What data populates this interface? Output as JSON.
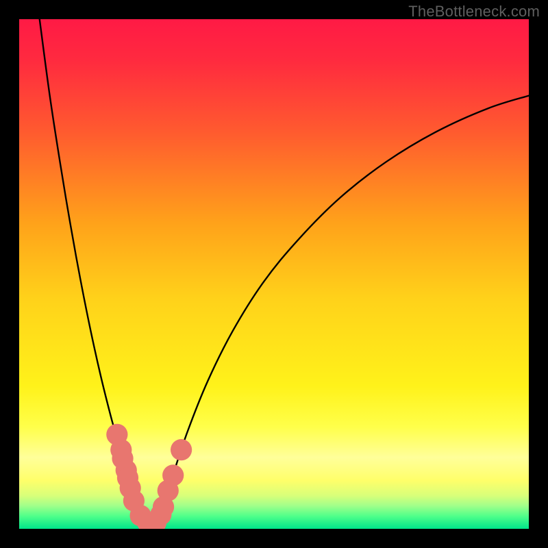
{
  "watermark": "TheBottleneck.com",
  "chart_data": {
    "type": "line",
    "title": "",
    "xlabel": "",
    "ylabel": "",
    "xlim": [
      0,
      100
    ],
    "ylim": [
      0,
      100
    ],
    "grid": false,
    "legend": false,
    "background": {
      "type": "vertical-gradient",
      "stops": [
        {
          "pos": 0.0,
          "color": "#ff1a45"
        },
        {
          "pos": 0.08,
          "color": "#ff2a3f"
        },
        {
          "pos": 0.22,
          "color": "#ff5a2f"
        },
        {
          "pos": 0.4,
          "color": "#ffa21a"
        },
        {
          "pos": 0.55,
          "color": "#ffd21a"
        },
        {
          "pos": 0.72,
          "color": "#fff21a"
        },
        {
          "pos": 0.8,
          "color": "#ffff4a"
        },
        {
          "pos": 0.86,
          "color": "#ffff9a"
        },
        {
          "pos": 0.905,
          "color": "#ffff6a"
        },
        {
          "pos": 0.935,
          "color": "#d8ff7a"
        },
        {
          "pos": 0.955,
          "color": "#a0ff8a"
        },
        {
          "pos": 0.975,
          "color": "#50ff8a"
        },
        {
          "pos": 1.0,
          "color": "#00e68a"
        }
      ]
    },
    "series": [
      {
        "name": "curve-left",
        "values": [
          {
            "x": 4.0,
            "y": 100.0
          },
          {
            "x": 6.0,
            "y": 85.0
          },
          {
            "x": 8.0,
            "y": 72.0
          },
          {
            "x": 10.0,
            "y": 60.0
          },
          {
            "x": 12.0,
            "y": 49.0
          },
          {
            "x": 14.0,
            "y": 39.0
          },
          {
            "x": 16.0,
            "y": 30.0
          },
          {
            "x": 18.0,
            "y": 22.0
          },
          {
            "x": 19.0,
            "y": 18.5
          },
          {
            "x": 20.0,
            "y": 15.0
          },
          {
            "x": 21.0,
            "y": 11.5
          },
          {
            "x": 22.0,
            "y": 8.0
          },
          {
            "x": 23.0,
            "y": 5.0
          },
          {
            "x": 24.0,
            "y": 2.5
          },
          {
            "x": 25.0,
            "y": 1.2
          },
          {
            "x": 26.0,
            "y": 0.5
          }
        ]
      },
      {
        "name": "curve-right",
        "values": [
          {
            "x": 26.0,
            "y": 0.5
          },
          {
            "x": 27.0,
            "y": 1.5
          },
          {
            "x": 28.0,
            "y": 3.5
          },
          {
            "x": 29.0,
            "y": 6.5
          },
          {
            "x": 30.0,
            "y": 10.0
          },
          {
            "x": 33.0,
            "y": 19.0
          },
          {
            "x": 37.0,
            "y": 29.0
          },
          {
            "x": 42.0,
            "y": 39.0
          },
          {
            "x": 48.0,
            "y": 48.5
          },
          {
            "x": 55.0,
            "y": 57.0
          },
          {
            "x": 63.0,
            "y": 65.0
          },
          {
            "x": 72.0,
            "y": 72.0
          },
          {
            "x": 82.0,
            "y": 78.0
          },
          {
            "x": 92.0,
            "y": 82.5
          },
          {
            "x": 100.0,
            "y": 85.0
          }
        ]
      }
    ],
    "markers": {
      "name": "highlight-dots",
      "color": "#e8766f",
      "radius_approx": 2.1,
      "points": [
        {
          "x": 19.2,
          "y": 18.5
        },
        {
          "x": 20.0,
          "y": 15.5
        },
        {
          "x": 20.3,
          "y": 13.8
        },
        {
          "x": 21.0,
          "y": 11.5
        },
        {
          "x": 21.3,
          "y": 10.0
        },
        {
          "x": 21.8,
          "y": 8.0
        },
        {
          "x": 22.5,
          "y": 5.5
        },
        {
          "x": 23.8,
          "y": 2.6
        },
        {
          "x": 25.2,
          "y": 1.3
        },
        {
          "x": 26.8,
          "y": 1.2
        },
        {
          "x": 27.8,
          "y": 2.8
        },
        {
          "x": 28.3,
          "y": 4.3
        },
        {
          "x": 29.2,
          "y": 7.5
        },
        {
          "x": 30.2,
          "y": 10.5
        },
        {
          "x": 31.8,
          "y": 15.5
        }
      ]
    }
  }
}
